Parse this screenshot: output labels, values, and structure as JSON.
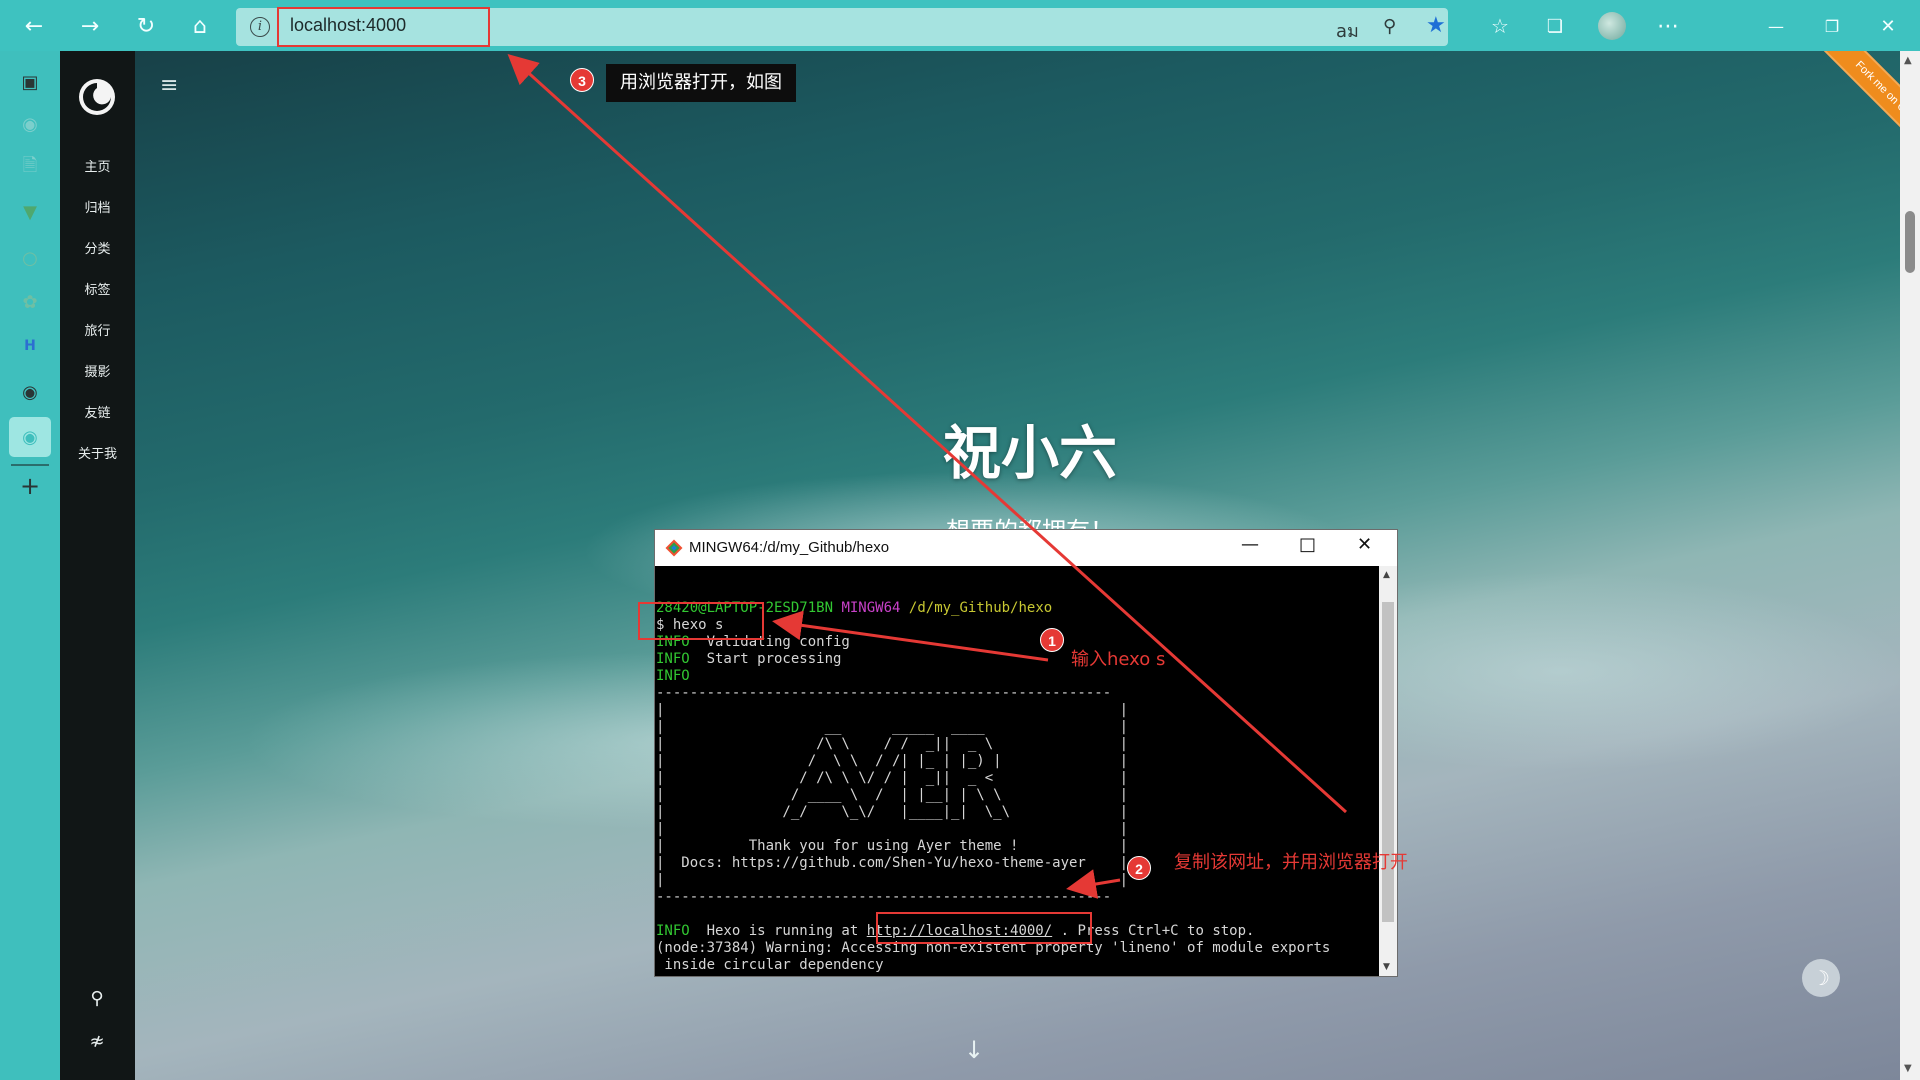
{
  "browser": {
    "url": "localhost:4000",
    "nav_icons": [
      "back-icon",
      "forward-icon",
      "refresh-icon",
      "home-icon"
    ],
    "addr_icons": [
      "info-icon",
      "read-aloud-icon",
      "zoom-icon",
      "favorite-star-icon"
    ],
    "toolbar_icons": [
      "favorites-icon",
      "collections-icon",
      "profile-avatar",
      "more-icon"
    ],
    "window_controls": [
      "minimize-icon",
      "restore-icon",
      "close-icon"
    ],
    "accent": "#3ec2c0"
  },
  "page": {
    "nav": [
      "主页",
      "归档",
      "分类",
      "标签",
      "旅行",
      "摄影",
      "友链",
      "关于我"
    ],
    "hero_title": "祝小六",
    "hero_subtitle": "想要的都拥有！",
    "ribbon": "Fork me on GitHub"
  },
  "terminal": {
    "title": "MINGW64:/d/my_Github/hexo",
    "prompt_user": "28420@LAPTOP-2ESD71BN",
    "prompt_env": "MINGW64",
    "prompt_path": "/d/my_Github/hexo",
    "command": "$ hexo s",
    "lines": [
      {
        "tag": "INFO",
        "text": "  Validating config"
      },
      {
        "tag": "INFO",
        "text": "  Start processing"
      },
      {
        "tag": "INFO",
        "text": ""
      }
    ],
    "banner": [
      "------------------------------------------------------",
      "|                                                      |",
      "|                   __      _____  ____                |",
      "|                  /\\ \\    / /  _||  _ \\               |",
      "|                 /  \\ \\  / /| |_ | |_) |              |",
      "|                / /\\ \\ \\/ / |  _||  _ <               |",
      "|               / ____ \\  /  | |__| | \\ \\              |",
      "|              /_/    \\_\\/   |____|_|  \\_\\             |",
      "|                                                      |",
      "|          Thank you for using Ayer theme !            |",
      "|  Docs: https://github.com/Shen-Yu/hexo-theme-ayer    |",
      "|                                                      |",
      "------------------------------------------------------"
    ],
    "running_tag": "INFO",
    "running_prefix": "  Hexo is running at ",
    "running_url": "http://localhost:4000/",
    "running_suffix": " . Press Ctrl+C to stop.",
    "warning": "(node:37384) Warning: Accessing non-existent property 'lineno' of module exports",
    "warning2": " inside circular dependency"
  },
  "annotations": {
    "step1_num": "1",
    "step1_text": "输入hexo s",
    "step2_num": "2",
    "step2_text": "复制该网址，并用浏览器打开",
    "step3_num": "3",
    "step3_text": "用浏览器打开，如图",
    "color": "#e53935"
  }
}
